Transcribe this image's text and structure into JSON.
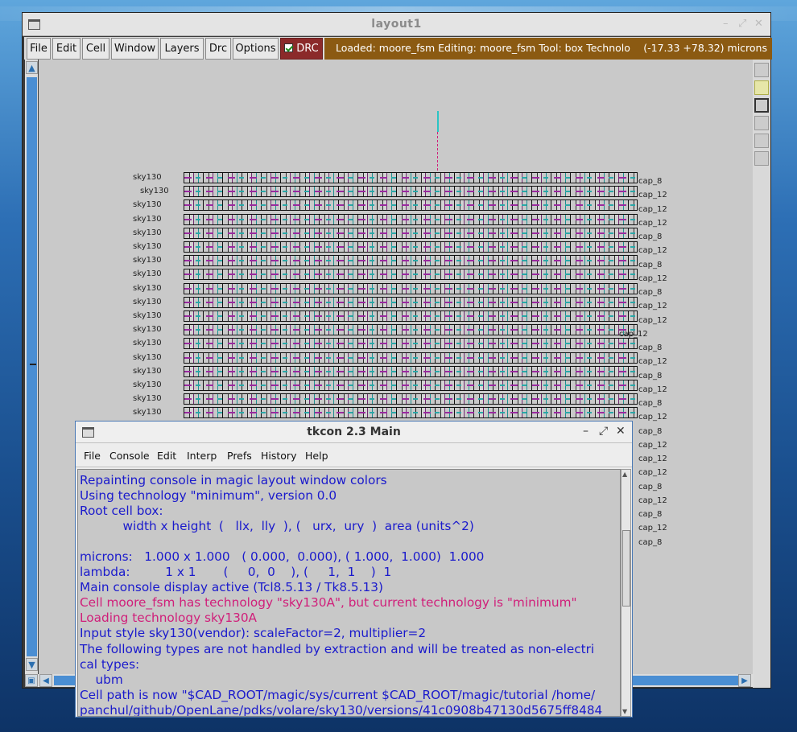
{
  "layout_window": {
    "title": "layout1",
    "menu": [
      "File",
      "Edit",
      "Cell",
      "Window",
      "Layers",
      "Drc",
      "Options"
    ],
    "drc_label": "DRC",
    "status": "Loaded: moore_fsm Editing: moore_fsm Tool: box  Technolog",
    "coords": "(-17.33 +78.32) microns",
    "left_labels": [
      "sky130",
      "sky130",
      "sky130",
      "sky130",
      "sky130",
      "sky130",
      "sky130",
      "sky130",
      "sky130",
      "sky130",
      "sky130",
      "sky130",
      "sky130",
      "sky130",
      "sky130",
      "sky130",
      "sky130",
      "sky130"
    ],
    "right_labels": [
      "cap_8",
      "cap_12",
      "cap_12",
      "cap_12",
      "cap_8",
      "cap_12",
      "cap_8",
      "cap_12",
      "cap_8",
      "cap_12",
      "cap_12",
      "cap_12",
      "cap_8",
      "cap_12",
      "cap_8",
      "cap_12",
      "cap_8",
      "cap_12",
      "cap_8",
      "cap_12",
      "cap_12",
      "cap_12",
      "cap_8",
      "cap_12",
      "cap_8",
      "cap_12",
      "cap_8"
    ]
  },
  "tkcon": {
    "title": "tkcon 2.3 Main",
    "menu": [
      "File",
      "Console",
      "Edit",
      "Interp",
      "Prefs",
      "History",
      "Help"
    ],
    "lines": [
      {
        "text": "Repainting console in magic layout window colors",
        "warn": false
      },
      {
        "text": "Using technology \"minimum\", version 0.0",
        "warn": false
      },
      {
        "text": "Root cell box:",
        "warn": false
      },
      {
        "text": "           width x height  (   llx,  lly  ), (   urx,  ury  )  area (units^2)",
        "warn": false
      },
      {
        "text": "",
        "warn": false
      },
      {
        "text": "microns:   1.000 x 1.000   ( 0.000,  0.000), ( 1.000,  1.000)  1.000",
        "warn": false
      },
      {
        "text": "lambda:         1 x 1       (     0,  0    ), (     1,  1    )  1",
        "warn": false
      },
      {
        "text": "Main console display active (Tcl8.5.13 / Tk8.5.13)",
        "warn": false
      },
      {
        "text": "Cell moore_fsm has technology \"sky130A\", but current technology is \"minimum\"",
        "warn": true
      },
      {
        "text": "Loading technology sky130A",
        "warn": true
      },
      {
        "text": "Input style sky130(vendor): scaleFactor=2, multiplier=2",
        "warn": false
      },
      {
        "text": "The following types are not handled by extraction and will be treated as non-electri",
        "warn": false
      },
      {
        "text": "cal types:",
        "warn": false
      },
      {
        "text": "    ubm",
        "warn": false
      },
      {
        "text": "Cell path is now \"$CAD_ROOT/magic/sys/current $CAD_ROOT/magic/tutorial /home/",
        "warn": false
      },
      {
        "text": "panchul/github/OpenLane/pdks/volare/sky130/versions/41c0908b47130d5675ff8484",
        "warn": false
      }
    ]
  }
}
